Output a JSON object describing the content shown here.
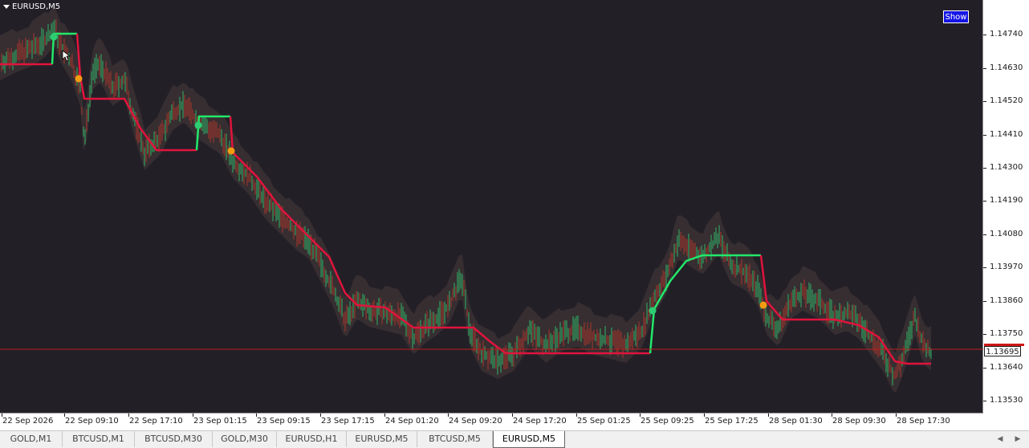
{
  "window": {
    "symbol_title": "EURUSD,M5",
    "show_button": "Show",
    "current_price": "1.13695"
  },
  "price_axis": {
    "labels": [
      "1.14740",
      "1.14630",
      "1.14520",
      "1.14410",
      "1.14300",
      "1.14190",
      "1.14080",
      "1.13970",
      "1.13860",
      "1.13750",
      "1.13640",
      "1.13530"
    ]
  },
  "time_axis": {
    "labels": [
      "22 Sep 2026",
      "22 Sep 09:10",
      "22 Sep 17:10",
      "23 Sep 01:15",
      "23 Sep 09:15",
      "23 Sep 17:15",
      "24 Sep 01:20",
      "24 Sep 09:20",
      "24 Sep 17:20",
      "25 Sep 01:25",
      "25 Sep 09:25",
      "25 Sep 17:25",
      "28 Sep 01:30",
      "28 Sep 09:30",
      "28 Sep 17:30"
    ]
  },
  "tabs": [
    {
      "label": "GOLD,M1",
      "active": false
    },
    {
      "label": "BTCUSD,M1",
      "active": false
    },
    {
      "label": "BTCUSD,M30",
      "active": false
    },
    {
      "label": "GOLD,M30",
      "active": false
    },
    {
      "label": "EURUSD,H1",
      "active": false
    },
    {
      "label": "EURUSD,M5",
      "active": false
    },
    {
      "label": "BTCUSD,M5",
      "active": false
    },
    {
      "label": "EURUSD,M5",
      "active": true
    }
  ],
  "colors": {
    "background": "#231f27",
    "bull_candle": "#2ecc71",
    "bear_candle": "#c0392b",
    "trend_up": "#22e86a",
    "trend_down": "#e0143c",
    "band_fill": "#3a3134",
    "signal_down": "#f39c12",
    "signal_up": "#2ecc71",
    "price_line": "#c81e1e"
  },
  "icons": {
    "title_dropdown": "triangle-down-icon",
    "cursor": "mouse-pointer-icon",
    "scroll_left": "chevron-left-icon",
    "scroll_right": "chevron-right-icon"
  }
}
